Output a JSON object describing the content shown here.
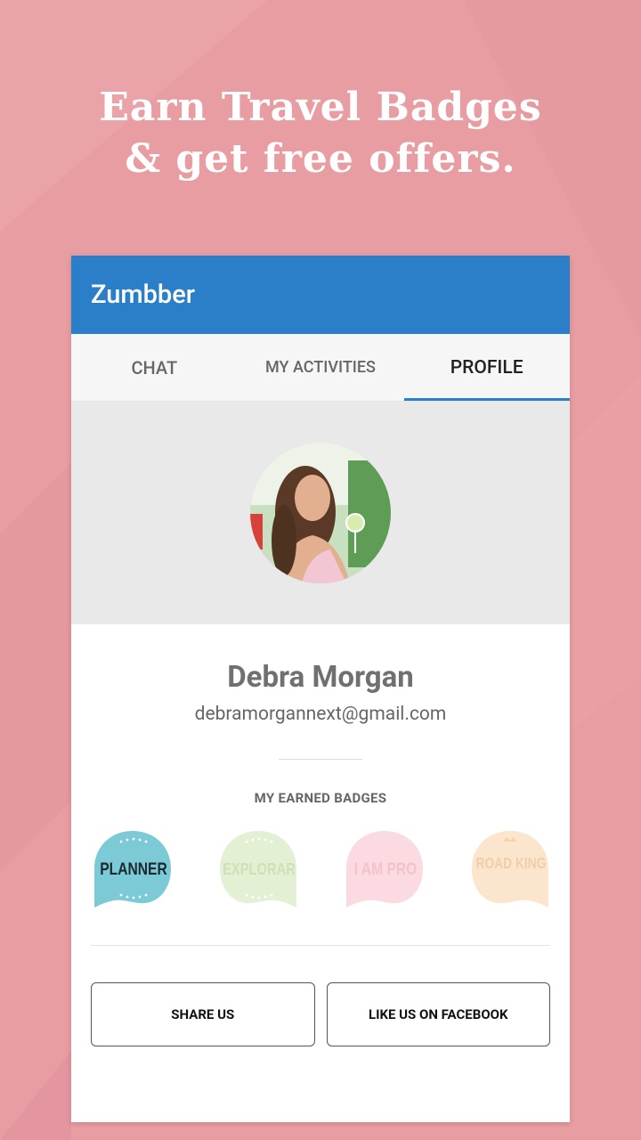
{
  "headline": {
    "line1": "Earn Travel Badges",
    "line2": "& get free offers."
  },
  "app": {
    "title": "Zumbber"
  },
  "tabs": [
    {
      "label": "CHAT",
      "active": false
    },
    {
      "label": "MY ACTIVITIES",
      "active": false
    },
    {
      "label": "PROFILE",
      "active": true
    }
  ],
  "profile": {
    "name": "Debra Morgan",
    "email": "debramorgannext@gmail.com"
  },
  "badges": {
    "title": "MY EARNED BADGES",
    "items": [
      {
        "label": "PLANNER",
        "earned": true,
        "color": "#7ccad6"
      },
      {
        "label": "EXPLORAR",
        "earned": false,
        "color": "#e4f0d4"
      },
      {
        "label": "I AM PRO",
        "earned": false,
        "color": "#fbdbe1"
      },
      {
        "label": "ROAD KING",
        "earned": false,
        "color": "#fbe5cd"
      }
    ]
  },
  "buttons": {
    "share": "SHARE US",
    "facebook": "LIKE US ON FACEBOOK"
  },
  "colors": {
    "background": "#e89da2",
    "appbar": "#2b7fc9",
    "accent": "#2b7fc9"
  }
}
